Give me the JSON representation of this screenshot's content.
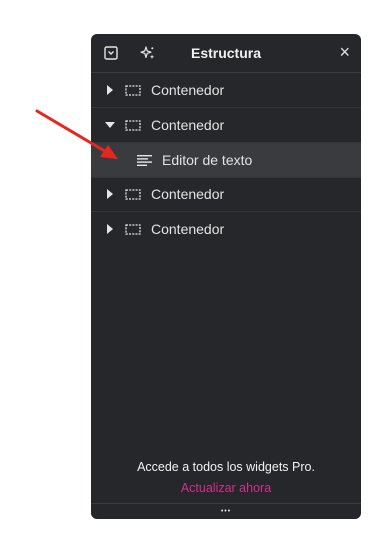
{
  "panel": {
    "title": "Estructura",
    "close_glyph": "×",
    "header_icons": [
      "dropdown-toggle-icon",
      "ai-sparkle-icon"
    ]
  },
  "tree": [
    {
      "label": "Contenedor",
      "expanded": false,
      "icon": "container-icon"
    },
    {
      "label": "Contenedor",
      "expanded": true,
      "icon": "container-icon"
    },
    {
      "label": "Editor de texto",
      "child": true,
      "selected": true,
      "icon": "text-editor-icon"
    },
    {
      "label": "Contenedor",
      "expanded": false,
      "icon": "container-icon"
    },
    {
      "label": "Contenedor",
      "expanded": false,
      "icon": "container-icon"
    }
  ],
  "footer": {
    "promo_text": "Accede a todos los widgets Pro.",
    "upgrade_link": "Actualizar ahora",
    "more_glyph": "•••"
  },
  "colors": {
    "panel_bg": "#26272b",
    "selected_row": "#3a3b3f",
    "link": "#d62d8d",
    "annotation_arrow": "#e8261f"
  }
}
